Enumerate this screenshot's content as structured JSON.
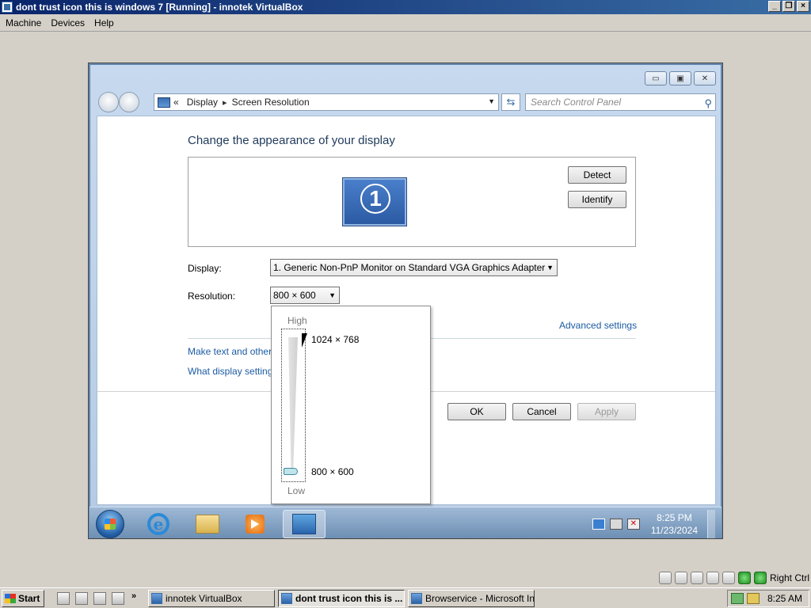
{
  "host": {
    "title": "dont trust icon this is windows 7 [Running] - innotek VirtualBox",
    "menu": [
      "Machine",
      "Devices",
      "Help"
    ],
    "status_hostkey": "Right Ctrl"
  },
  "explorer": {
    "breadcrumb_root": "«",
    "breadcrumb": [
      "Display",
      "Screen Resolution"
    ],
    "search_placeholder": "Search Control Panel"
  },
  "content": {
    "heading": "Change the appearance of your display",
    "monitor_number": "1",
    "detect_label": "Detect",
    "identify_label": "Identify",
    "display_label": "Display:",
    "display_value": "1. Generic Non-PnP Monitor on Standard VGA Graphics Adapter",
    "resolution_label": "Resolution:",
    "resolution_value": "800 × 600",
    "advanced_link": "Advanced settings",
    "link1": "Make text and other",
    "link2": "What display setting",
    "ok_label": "OK",
    "cancel_label": "Cancel",
    "apply_label": "Apply"
  },
  "resolution_dropdown": {
    "high_label": "High",
    "low_label": "Low",
    "option_high": "1024 × 768",
    "option_low": "800 × 600",
    "slider_fraction": 0.0
  },
  "guest_taskbar": {
    "time": "8:25 PM",
    "date": "11/23/2024"
  },
  "host_taskbar": {
    "start_label": "Start",
    "tasks": [
      "innotek VirtualBox",
      "dont trust icon this is ...",
      "Browservice - Microsoft Int..."
    ],
    "time": "8:25 AM"
  }
}
